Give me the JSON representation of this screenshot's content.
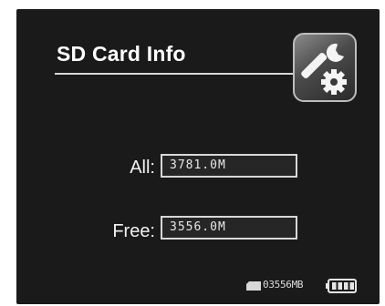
{
  "screen": {
    "title": "SD Card Info",
    "settings_icon": "wrench-gear-icon"
  },
  "storage": {
    "all_label": "All:",
    "all_value": "3781.0M",
    "free_label": "Free:",
    "free_value": "3556.0M"
  },
  "status_bar": {
    "sd_icon": "sd-card-icon",
    "remaining": "03556MB",
    "battery_icon": "battery-icon",
    "battery_level": 1.0
  },
  "colors": {
    "background": "#1a1a1a",
    "text": "#f2f2f2",
    "field_border": "#d8d8d8"
  }
}
